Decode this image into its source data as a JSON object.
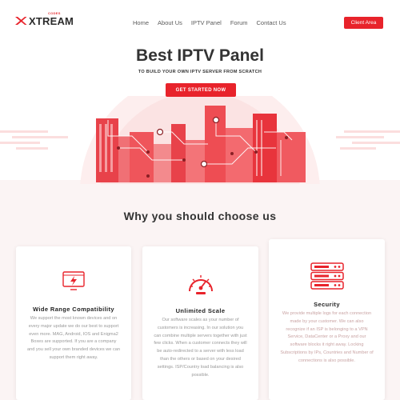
{
  "brand": {
    "name": "XTREAM",
    "sub": "CODES",
    "accent": "#e8232b"
  },
  "nav": {
    "items": [
      "Home",
      "About Us",
      "IPTV Panel",
      "Forum",
      "Contact Us"
    ],
    "client_area": "Client Area"
  },
  "hero": {
    "title": "Best IPTV Panel",
    "subtitle": "TO BUILD YOUR OWN IPTV SERVER FROM SCRATCH",
    "cta": "GET STARTED NOW"
  },
  "features": {
    "title": "Why you should choose us",
    "cards": [
      {
        "icon": "flash-monitor-icon",
        "title": "Wide Range Compatibility",
        "text": "We support the most known devices and on every major update we do our best to support even more. MAG, Android, IOS and Enigma2 Boxes are supported. If you are a company and you sell your own branded devices we can support them right away."
      },
      {
        "icon": "speedometer-icon",
        "title": "Unlimited Scale",
        "text": "Our software scales as your number of customers is increasing. In our solution you can combine multiple servers together with just few clicks. When a customer connects they will be auto-redirected to a server with less load than the others or based on your desired settings. ISP/Country load balancing is also possible."
      },
      {
        "icon": "server-stack-icon",
        "title": "Security",
        "text": "We provide multiple logs for each connection made by your customer. We can also recognize if an ISP is belonging to a VPN Service, DataCenter or a Proxy and our software blocks it right away. Locking Subscriptions by IPs, Countries and Number of connections is also possible."
      }
    ]
  }
}
